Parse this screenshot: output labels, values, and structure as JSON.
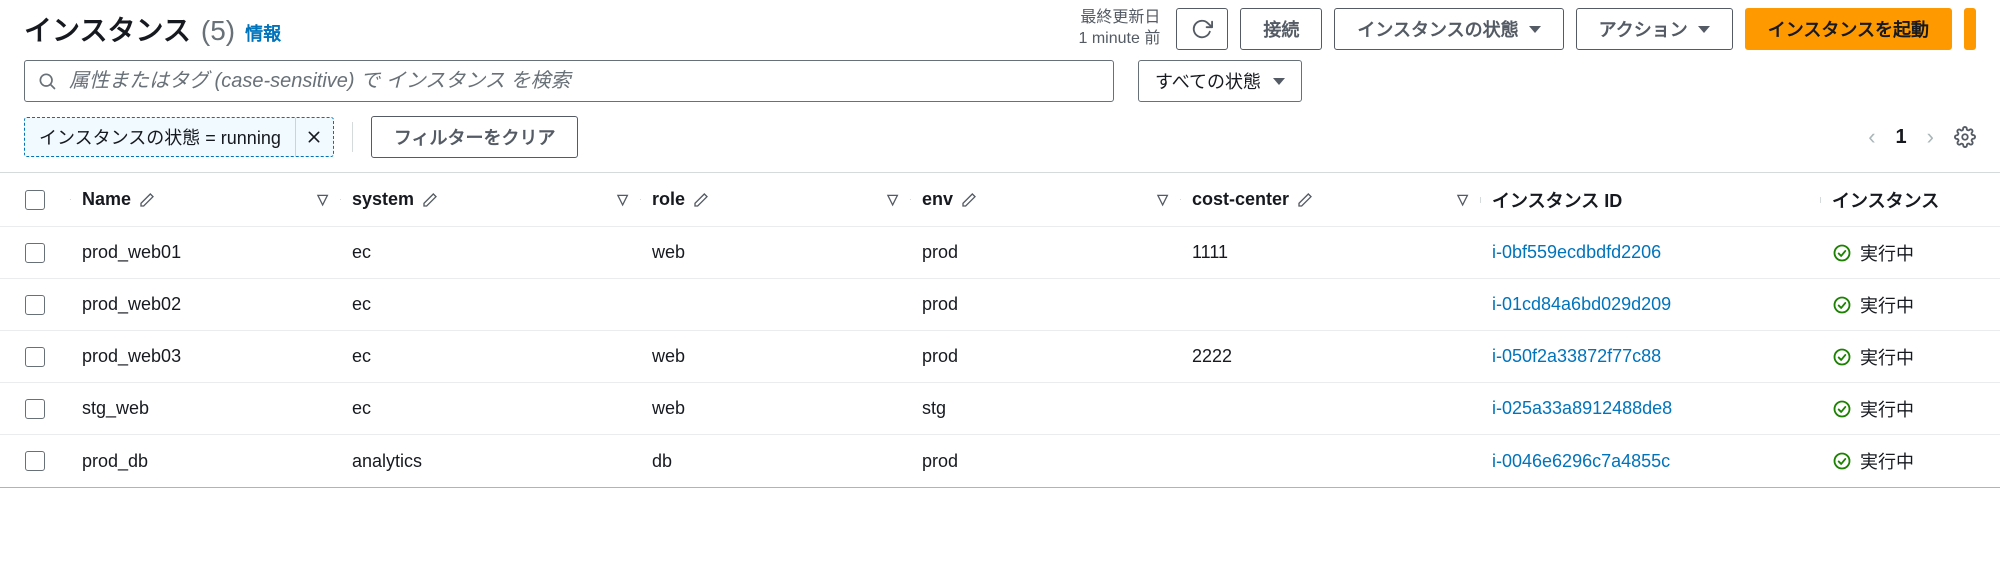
{
  "header": {
    "title": "インスタンス",
    "count": "(5)",
    "info_link": "情報",
    "last_updated_label": "最終更新日",
    "last_updated_value": "1 minute 前"
  },
  "toolbar": {
    "refresh_aria": "refresh",
    "connect_label": "接続",
    "instance_state_label": "インスタンスの状態",
    "actions_label": "アクション",
    "launch_label": "インスタンスを起動"
  },
  "search": {
    "placeholder": "属性またはタグ (case-sensitive) で インスタンス を検索",
    "state_filter_label": "すべての状態"
  },
  "filters": {
    "chip_text": "インスタンスの状態 = running",
    "clear_label": "フィルターをクリア"
  },
  "pager": {
    "page": "1"
  },
  "columns": {
    "name": "Name",
    "system": "system",
    "role": "role",
    "env": "env",
    "cost": "cost-center",
    "iid": "インスタンス ID",
    "state": "インスタンス"
  },
  "status_running": "実行中",
  "rows": [
    {
      "name": "prod_web01",
      "system": "ec",
      "role": "web",
      "env": "prod",
      "cost": "1111",
      "iid": "i-0bf559ecdbdfd2206"
    },
    {
      "name": "prod_web02",
      "system": "ec",
      "role": "",
      "env": "prod",
      "cost": "",
      "iid": "i-01cd84a6bd029d209"
    },
    {
      "name": "prod_web03",
      "system": "ec",
      "role": "web",
      "env": "prod",
      "cost": "2222",
      "iid": "i-050f2a33872f77c88"
    },
    {
      "name": "stg_web",
      "system": "ec",
      "role": "web",
      "env": "stg",
      "cost": "",
      "iid": "i-025a33a8912488de8"
    },
    {
      "name": "prod_db",
      "system": "analytics",
      "role": "db",
      "env": "prod",
      "cost": "",
      "iid": "i-0046e6296c7a4855c"
    }
  ]
}
